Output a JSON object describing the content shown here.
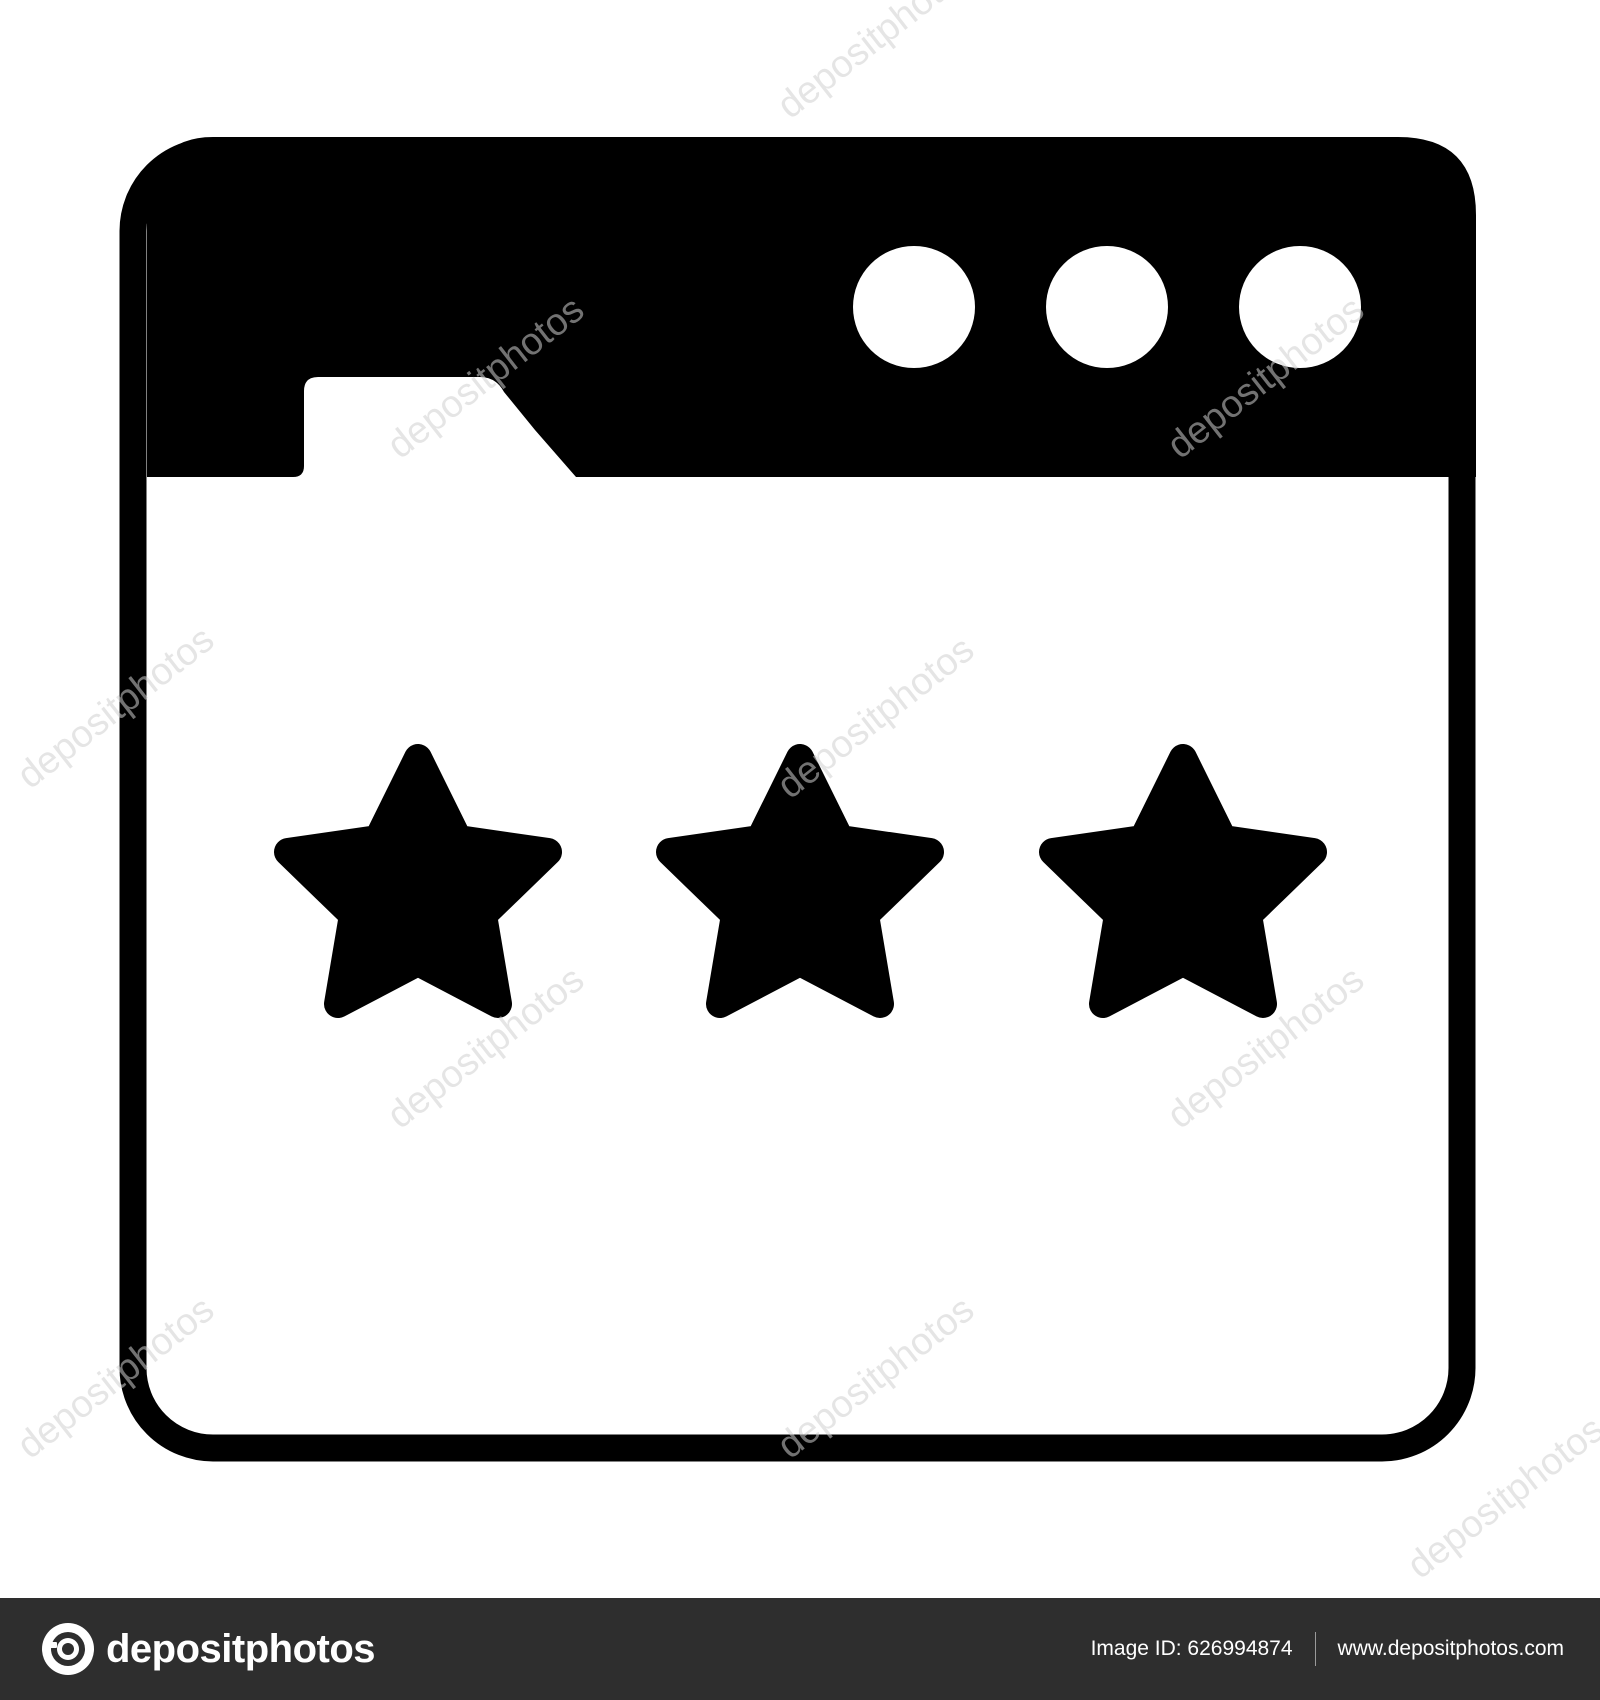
{
  "icon": {
    "name": "browser-folder-rating-icon",
    "window_dots": 3,
    "rating_stars": 3,
    "fill_color": "#000000",
    "background_color": "#ffffff"
  },
  "watermark": {
    "text": "depositphotos",
    "color": "#d8d8d8"
  },
  "footer": {
    "brand_name": "depositphotos",
    "image_id": "Image ID: 626994874",
    "site_url": "www.depositphotos.com",
    "background_color": "#2e2e2e"
  }
}
